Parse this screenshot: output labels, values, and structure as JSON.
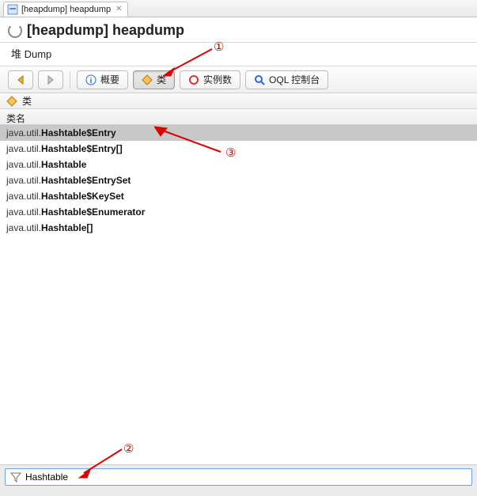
{
  "window_tab": {
    "label": "[heapdump] heapdump"
  },
  "title": {
    "text": "[heapdump] heapdump"
  },
  "subheader": {
    "label": "堆 Dump"
  },
  "toolbar": {
    "overview_label": "概要",
    "classes_label": "类",
    "instances_label": "实例数",
    "oql_label": "OQL 控制台"
  },
  "section": {
    "header_label": "类",
    "column_header": "类名"
  },
  "classes": [
    {
      "pkg": "java.util.",
      "cls": "Hashtable$Entry",
      "selected": true
    },
    {
      "pkg": "java.util.",
      "cls": "Hashtable$Entry[]",
      "selected": false
    },
    {
      "pkg": "java.util.",
      "cls": "Hashtable",
      "selected": false
    },
    {
      "pkg": "java.util.",
      "cls": "Hashtable$EntrySet",
      "selected": false
    },
    {
      "pkg": "java.util.",
      "cls": "Hashtable$KeySet",
      "selected": false
    },
    {
      "pkg": "java.util.",
      "cls": "Hashtable$Enumerator",
      "selected": false
    },
    {
      "pkg": "java.util.",
      "cls": "Hashtable[]",
      "selected": false
    }
  ],
  "filter": {
    "value": "Hashtable"
  },
  "annotations": {
    "a1": "①",
    "a2": "②",
    "a3": "③"
  }
}
